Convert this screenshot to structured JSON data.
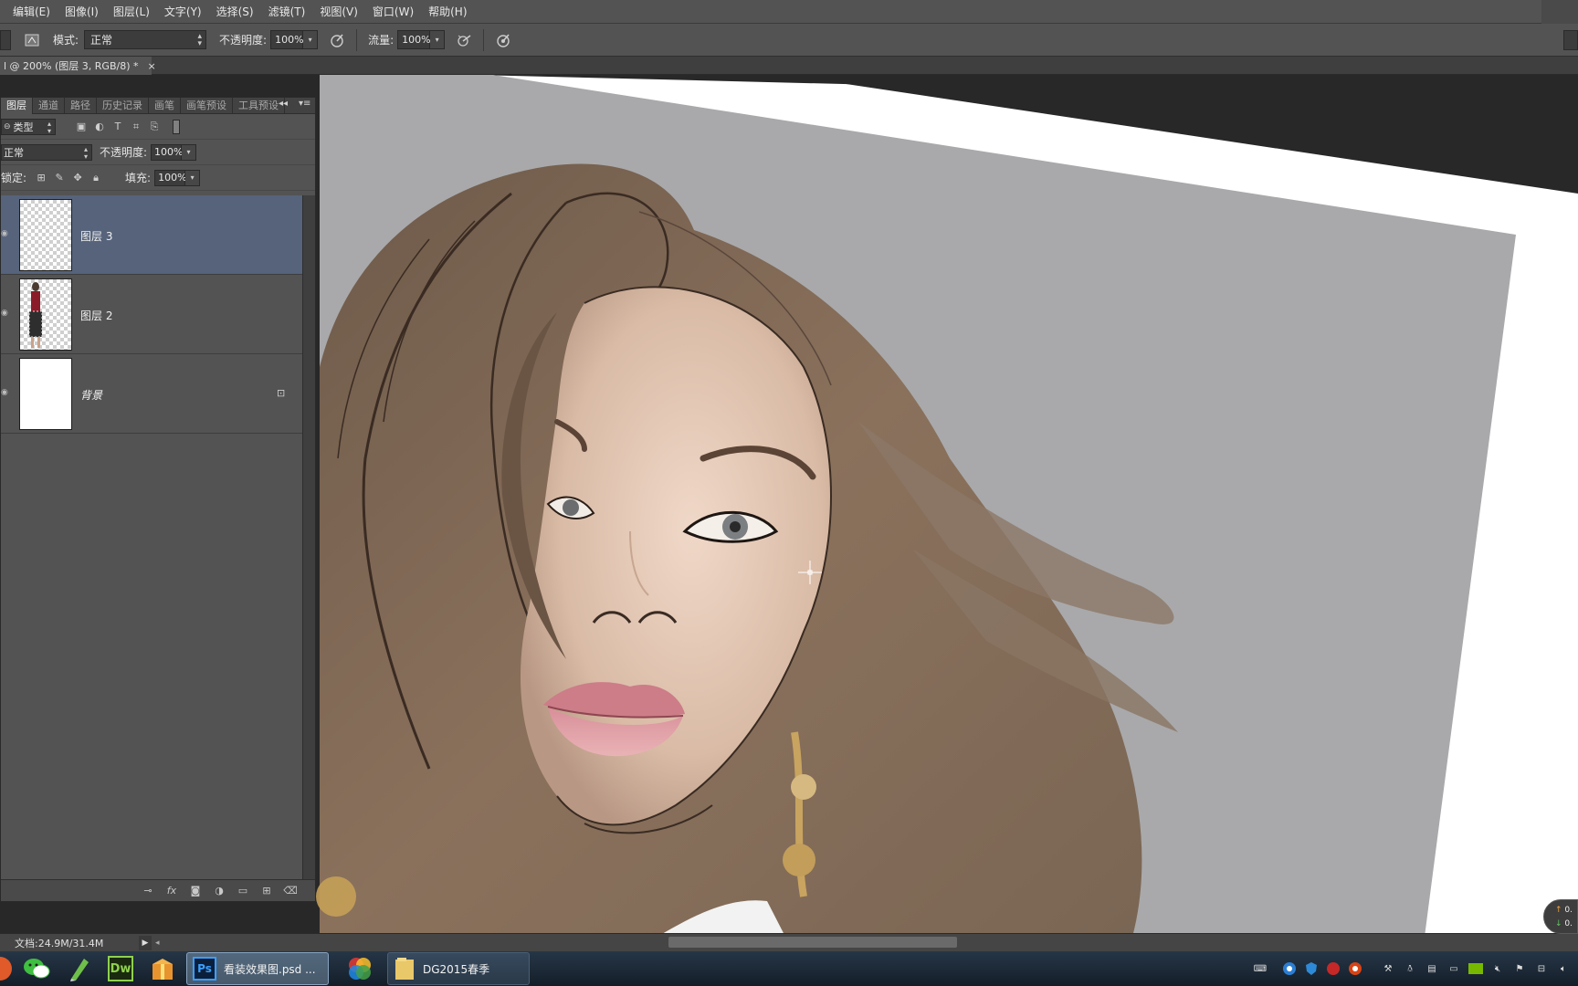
{
  "menu": [
    "编辑(E)",
    "图像(I)",
    "图层(L)",
    "文字(Y)",
    "选择(S)",
    "滤镜(T)",
    "视图(V)",
    "窗口(W)",
    "帮助(H)"
  ],
  "options": {
    "mode_label": "模式:",
    "mode_value": "正常",
    "opacity_label": "不透明度:",
    "opacity_value": "100%",
    "flow_label": "流量:",
    "flow_value": "100%"
  },
  "document_tab": {
    "title": "l @ 200% (图层 3, RGB/8) *",
    "close": "×"
  },
  "layers_panel": {
    "tabs": [
      "图层",
      "通道",
      "路径",
      "历史记录",
      "画笔",
      "画笔预设",
      "工具预设"
    ],
    "filter_kind": "类型",
    "blend_mode": "正常",
    "opacity_label": "不透明度:",
    "opacity_value": "100%",
    "lock_label": "锁定:",
    "fill_label": "填充:",
    "fill_value": "100%",
    "layers": [
      {
        "name": "图层 3",
        "selected": true,
        "thumbnail": "transparent"
      },
      {
        "name": "图层 2",
        "selected": false,
        "thumbnail": "model-figure"
      },
      {
        "name": "背景",
        "selected": false,
        "thumbnail": "white",
        "locked": true
      }
    ]
  },
  "status": {
    "doc_size": "文档:24.9M/31.4M"
  },
  "taskbar": {
    "items": [
      {
        "label": "看装效果图.psd ...",
        "icon": "photoshop-icon",
        "active": true
      },
      {
        "label": "DG2015春季",
        "icon": "folder-icon",
        "active": false
      }
    ],
    "pinned": [
      "wechat-icon",
      "pen-tool-app-icon",
      "dreamweaver-icon",
      "package-icon",
      "color-wheel-icon"
    ],
    "dw_text": "Dw",
    "ps_text": "Ps"
  },
  "net_badge": {
    "up": "0.",
    "down": "0."
  },
  "colors": {
    "ui_bg": "#535353",
    "canvas_bg": "#282828",
    "selected_layer": "#56637b",
    "photo_bg": "#a9a9ab"
  }
}
